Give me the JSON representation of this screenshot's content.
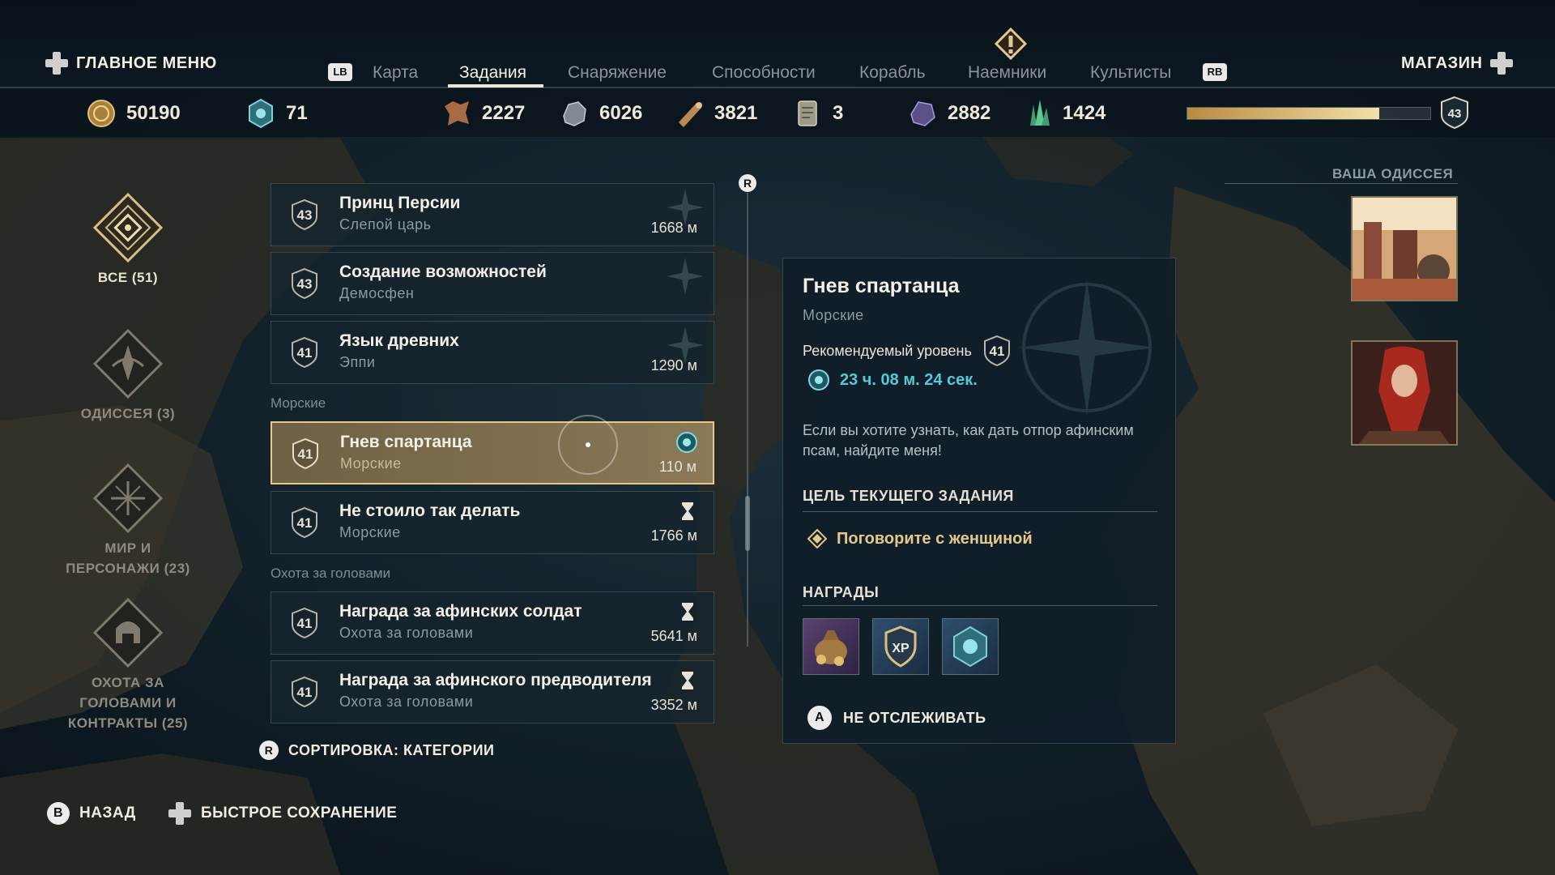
{
  "header": {
    "main_menu": "ГЛАВНОЕ МЕНЮ",
    "shop": "МАГАЗИН",
    "lb": "LB",
    "rb": "RB",
    "tabs": [
      {
        "label": "Карта",
        "active": false
      },
      {
        "label": "Задания",
        "active": true
      },
      {
        "label": "Снаряжение",
        "active": false
      },
      {
        "label": "Способности",
        "active": false
      },
      {
        "label": "Корабль",
        "active": false
      },
      {
        "label": "Наемники",
        "active": false
      },
      {
        "label": "Культисты",
        "active": false
      }
    ]
  },
  "resources": {
    "drachmae": "50190",
    "orichalcum": "71",
    "leather": "2227",
    "iron": "6026",
    "wood": "3821",
    "tablets": "3",
    "obsidian": "2882",
    "crystal": "1424",
    "xp_progress": 0.79,
    "level": "43"
  },
  "categories": [
    {
      "label": "ВСЕ (51)",
      "active": true
    },
    {
      "label": "ОДИССЕЯ (3)",
      "active": false
    },
    {
      "label": "МИР И ПЕРСОНАЖИ (23)",
      "active": false
    },
    {
      "label": "ОХОТА ЗА ГОЛОВАМИ И КОНТРАКТЫ (25)",
      "active": false
    }
  ],
  "quests": {
    "items": [
      {
        "level": "43",
        "title": "Принц Персии",
        "subtitle": "Слепой царь",
        "distance": "1668 м"
      },
      {
        "level": "43",
        "title": "Создание возможностей",
        "subtitle": "Демосфен",
        "distance": ""
      },
      {
        "level": "41",
        "title": "Язык древних",
        "subtitle": "Эппи",
        "distance": "1290 м"
      },
      {
        "level": "41",
        "title": "Гнев спартанца",
        "subtitle": "Морские",
        "distance": "110 м"
      },
      {
        "level": "41",
        "title": "Не стоило так делать",
        "subtitle": "Морские",
        "distance": "1766 м"
      },
      {
        "level": "41",
        "title": "Награда за афинских солдат",
        "subtitle": "Охота за головами",
        "distance": "5641 м"
      },
      {
        "level": "41",
        "title": "Награда за афинского предводителя",
        "subtitle": "Охота за головами",
        "distance": "3352 м"
      }
    ],
    "section_sea": "Морские",
    "section_bounty": "Охота за головами",
    "sort_label": "СОРТИРОВКА: КАТЕГОРИИ",
    "r_badge": "R"
  },
  "detail": {
    "title": "Гнев спартанца",
    "category": "Морские",
    "recommended_label": "Рекомендуемый уровень",
    "recommended_level": "41",
    "timer": "23 ч. 08 м. 24 сек.",
    "description": "Если вы хотите узнать, как дать отпор афинским псам, найдите меня!",
    "objective_heading": "ЦЕЛЬ ТЕКУЩЕГО ЗАДАНИЯ",
    "objective": "Поговорите с женщиной",
    "rewards_heading": "НАГРАДЫ",
    "xp_label": "XP",
    "untrack_button": "A",
    "untrack_label": "НЕ ОТСЛЕЖИВАТЬ"
  },
  "odyssey": {
    "title": "ВАША ОДИССЕЯ"
  },
  "footer": {
    "back_button": "B",
    "back_label": "НАЗАД",
    "quicksave_label": "БЫСТРОЕ СОХРАНЕНИЕ"
  },
  "colors": {
    "accent_gold": "#e3c98c",
    "timer_cyan": "#56c9d6",
    "panel_bg": "#101e28"
  }
}
